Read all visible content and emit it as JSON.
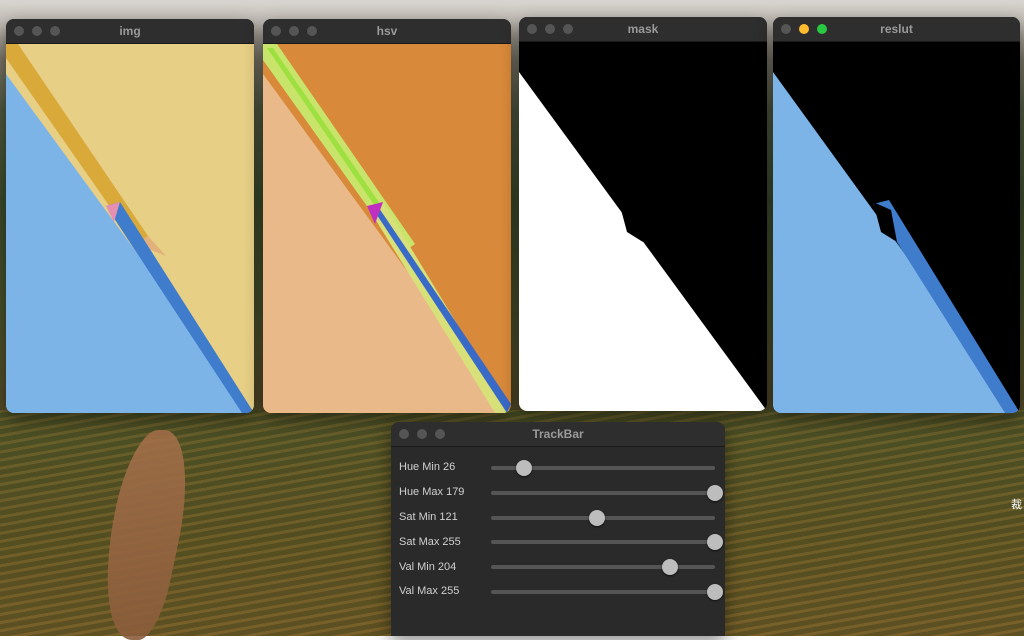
{
  "desktop": {
    "edge_text": "裁"
  },
  "windows": [
    {
      "title": "img",
      "lights": [
        "gray",
        "gray",
        "gray"
      ]
    },
    {
      "title": "hsv",
      "lights": [
        "gray",
        "gray",
        "gray"
      ]
    },
    {
      "title": "mask",
      "lights": [
        "gray",
        "gray",
        "gray"
      ]
    },
    {
      "title": "reslut",
      "lights": [
        "gray",
        "yellow",
        "green"
      ]
    }
  ],
  "trackbar": {
    "title": "TrackBar",
    "sliders": [
      {
        "label": "Hue Min 26",
        "value": 26,
        "max": 179
      },
      {
        "label": "Hue Max 179",
        "value": 179,
        "max": 179
      },
      {
        "label": "Sat Min 121",
        "value": 121,
        "max": 255
      },
      {
        "label": "Sat Max 255",
        "value": 255,
        "max": 255
      },
      {
        "label": "Val Min 204",
        "value": 204,
        "max": 255
      },
      {
        "label": "Val Max 255",
        "value": 255,
        "max": 255
      }
    ]
  }
}
